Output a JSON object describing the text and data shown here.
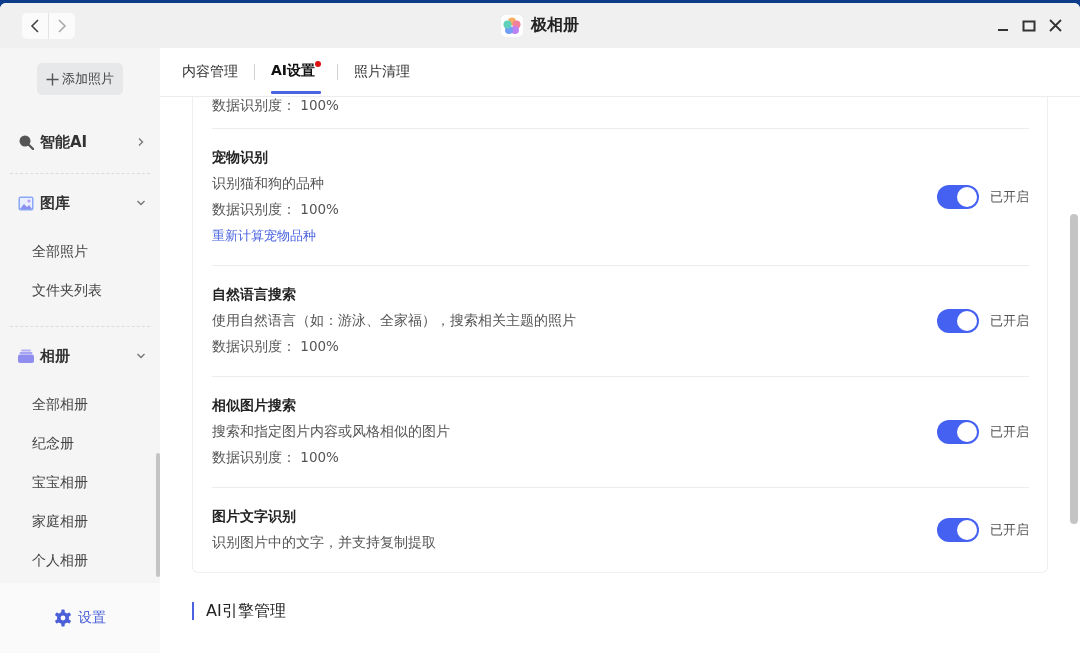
{
  "window": {
    "title": "极相册"
  },
  "sidebar": {
    "add_button": "添加照片",
    "sections": [
      {
        "label": "智能AI",
        "expanded": false
      },
      {
        "label": "图库",
        "expanded": true,
        "items": [
          {
            "label": "全部照片"
          },
          {
            "label": "文件夹列表"
          }
        ]
      },
      {
        "label": "相册",
        "expanded": true,
        "items": [
          {
            "label": "全部相册"
          },
          {
            "label": "纪念册"
          },
          {
            "label": "宝宝相册"
          },
          {
            "label": "家庭相册"
          },
          {
            "label": "个人相册"
          }
        ]
      }
    ],
    "settings": "设置"
  },
  "tabs": [
    {
      "label": "内容管理",
      "selected": false,
      "dot": false
    },
    {
      "label": "AI设置",
      "selected": true,
      "dot": true
    },
    {
      "label": "照片清理",
      "selected": false,
      "dot": false
    }
  ],
  "content": {
    "top_partial": "数据识别度： 100%",
    "items": [
      {
        "title": "宠物识别",
        "description": "识别猫和狗的品种",
        "accuracy": "数据识别度： 100%",
        "action": "重新计算宠物品种",
        "on": true,
        "toggle_label": "已开启"
      },
      {
        "title": "自然语言搜索",
        "description": "使用自然语言（如：游泳、全家福），搜索相关主题的照片",
        "accuracy": "数据识别度： 100%",
        "on": true,
        "toggle_label": "已开启"
      },
      {
        "title": "相似图片搜索",
        "description": "搜索和指定图片内容或风格相似的图片",
        "accuracy": "数据识别度： 100%",
        "on": true,
        "toggle_label": "已开启"
      },
      {
        "title": "图片文字识别",
        "description": "识别图片中的文字，并支持复制提取",
        "on": true,
        "toggle_label": "已开启"
      }
    ],
    "section_heading": "AI引擎管理"
  }
}
